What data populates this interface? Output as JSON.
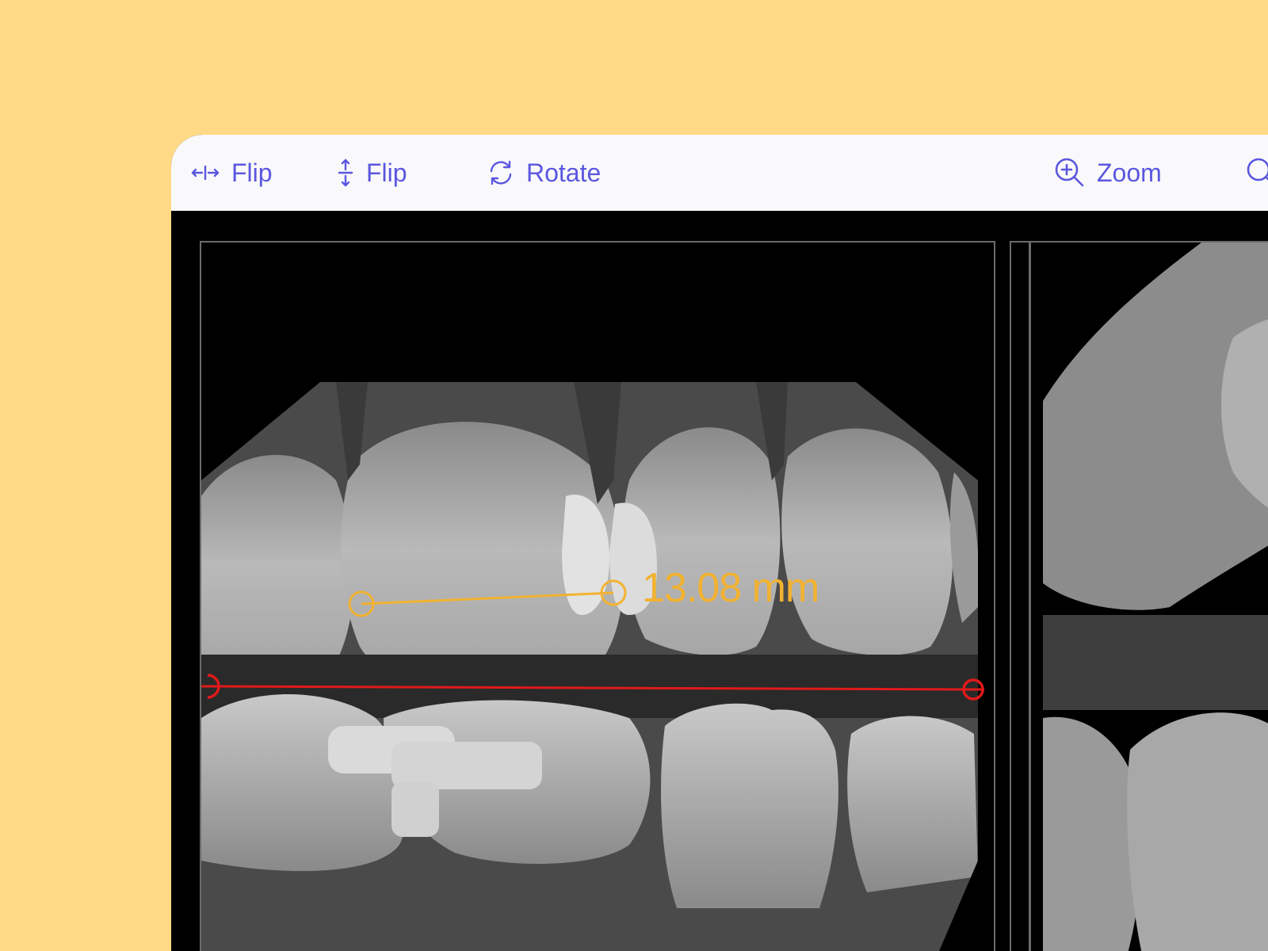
{
  "toolbar": {
    "flip_h_label": "Flip",
    "flip_v_label": "Flip",
    "rotate_label": "Rotate",
    "zoom_label": "Zoom",
    "accent_color": "#5B57E0"
  },
  "image": {
    "measurement_label": "13.08 mm",
    "measurement_color": "#F2B230",
    "reference_line_color": "#E01A1A"
  },
  "icons": [
    "flip-horizontal-icon",
    "flip-vertical-icon",
    "rotate-icon",
    "zoom-in-icon",
    "search-icon"
  ],
  "background_color": "#FFD985"
}
